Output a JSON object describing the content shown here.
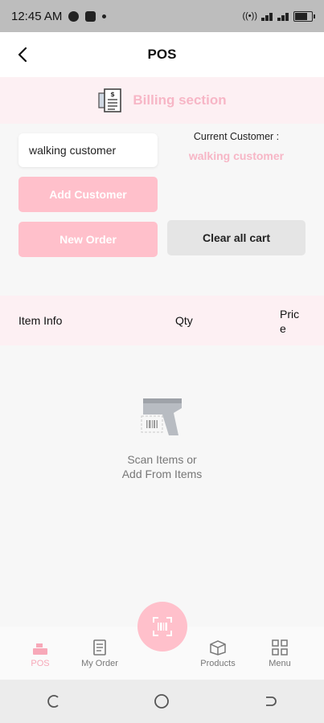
{
  "status_bar": {
    "time": "12:45 AM"
  },
  "app_bar": {
    "title": "POS"
  },
  "billing": {
    "title": "Billing section"
  },
  "customer": {
    "input_value": "walking customer",
    "current_label": "Current Customer :",
    "current_name": "walking customer"
  },
  "actions": {
    "add_customer": "Add Customer",
    "new_order": "New Order",
    "clear_cart": "Clear all cart"
  },
  "table": {
    "col_item": "Item Info",
    "col_qty": "Qty",
    "col_price_line1": "Pric",
    "col_price_line2": "e"
  },
  "empty_state": {
    "line1": "Scan Items or",
    "line2": "Add From Items"
  },
  "bottom_nav": {
    "pos": "POS",
    "my_order": "My Order",
    "products": "Products",
    "menu": "Menu"
  },
  "colors": {
    "accent": "#ffc0cb",
    "accent_text": "#f7b6c6",
    "header_bg": "#fdf0f3"
  }
}
